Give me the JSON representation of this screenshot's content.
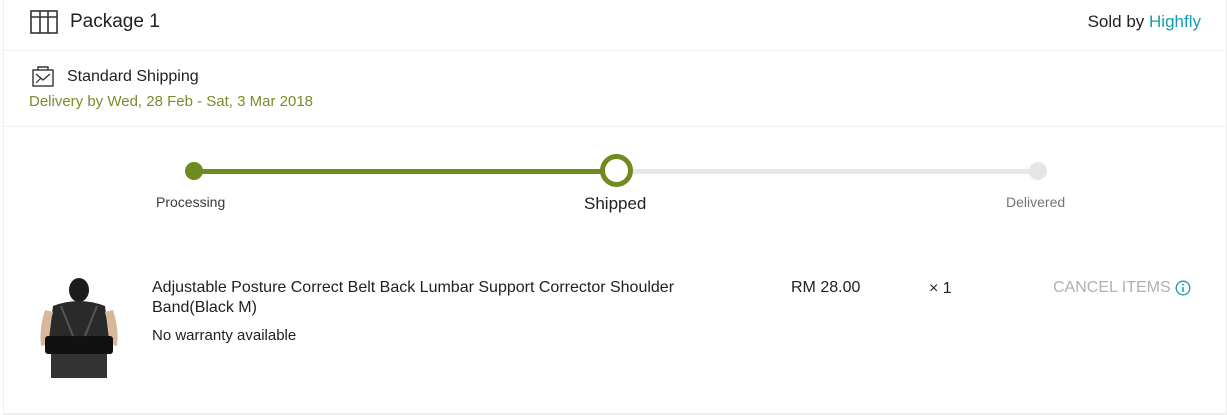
{
  "package": {
    "title": "Package 1",
    "sold_by_label": "Sold by",
    "seller_name": "Highfly",
    "seller_color": "#1a9cb0"
  },
  "shipping": {
    "method": "Standard Shipping",
    "eta": "Delivery by Wed, 28 Feb - Sat, 3 Mar 2018",
    "eta_color": "#7a8c2a"
  },
  "tracker": {
    "steps": [
      {
        "label": "Processing",
        "state": "done"
      },
      {
        "label": "Shipped",
        "state": "current"
      },
      {
        "label": "Delivered",
        "state": "pending"
      }
    ],
    "progress_color": "#6f8a1f",
    "progress": 0.5
  },
  "item": {
    "title": "Adjustable Posture Correct Belt Back Lumbar Support Corrector Shoulder Band(Black M)",
    "warranty": "No warranty available",
    "price": "RM 28.00",
    "quantity": "× 1",
    "cancel_label": "CANCEL ITEMS"
  },
  "icons": {
    "package": "package-icon",
    "shipping": "truck-box-icon",
    "info": "info-icon"
  }
}
